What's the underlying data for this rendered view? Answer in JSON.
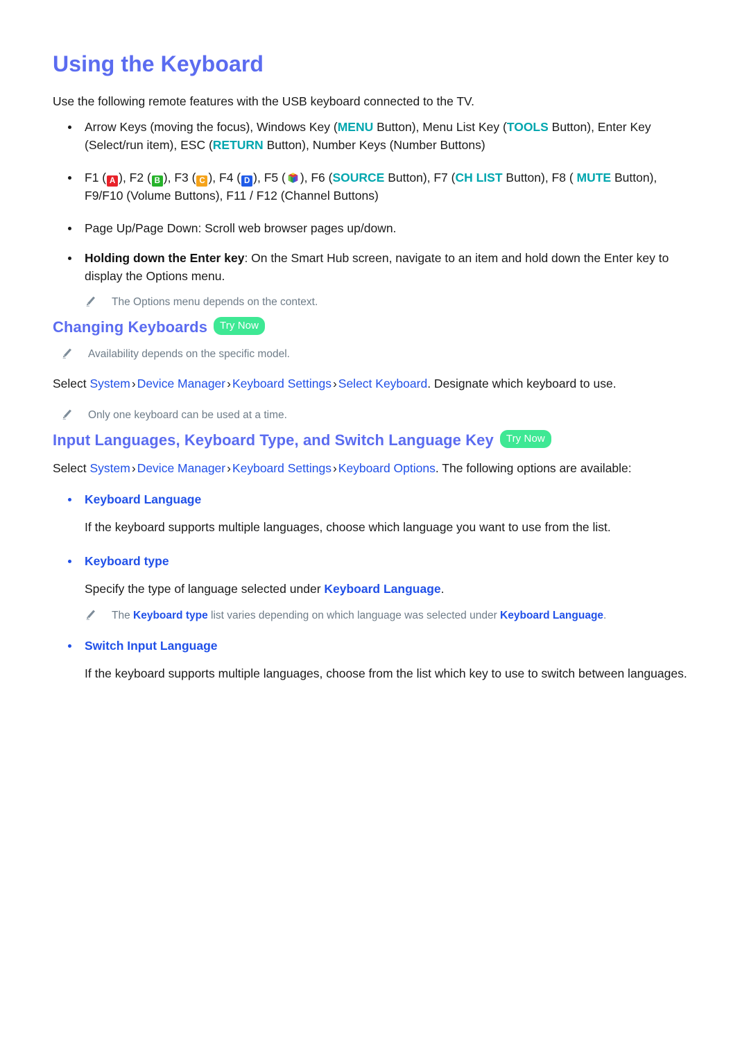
{
  "document": {
    "title": "Using the Keyboard",
    "intro": "Use the following remote features with the USB keyboard connected to the TV."
  },
  "bullets": {
    "arrow_keys": {
      "t1": "Arrow Keys (moving the focus), Windows Key (",
      "menu": "MENU",
      "t2": " Button), Menu List Key (",
      "tools": "TOOLS",
      "t3": " Button), Enter Key (Select/run item), ESC (",
      "return": "RETURN",
      "t4": " Button), Number Keys (Number Buttons)"
    },
    "function_keys": {
      "t1": "F1 (",
      "btn_a": "A",
      "t2": "), F2 (",
      "btn_b": "B",
      "t3": "), F3 (",
      "btn_c": "C",
      "t4": "), F4 (",
      "btn_d": "D",
      "t5": "), F5 (",
      "hub_icon": "smart-hub-icon",
      "t6": "), F6 (",
      "source": "SOURCE",
      "t7": " Button), F7 (",
      "ch_list": "CH LIST",
      "t8": " Button), F8 ( ",
      "mute": "MUTE",
      "t9": " Button), F9/F10 (Volume Buttons), F11 / F12 (Channel Buttons)"
    },
    "page_updown": "Page Up/Page Down: Scroll web browser pages up/down.",
    "enter_key": {
      "label": "Holding down the Enter key",
      "text": ": On the Smart Hub screen, navigate to an item and hold down the Enter key to display the Options menu."
    }
  },
  "notes": {
    "options_context": "The Options menu depends on the context.",
    "availability": "Availability depends on the specific model.",
    "one_keyboard": "Only one keyboard can be used at a time.",
    "keyboard_type_note": {
      "t1": "The ",
      "b1": "Keyboard type",
      "t2": " list varies depending on which language was selected under ",
      "b2": "Keyboard Language",
      "t3": "."
    }
  },
  "sections": {
    "changing_keyboards": {
      "heading": "Changing Keyboards",
      "badge": "Try Now",
      "path": {
        "prefix": "Select ",
        "items": [
          "System",
          "Device Manager",
          "Keyboard Settings",
          "Select Keyboard"
        ],
        "separator": "›",
        "suffix": ". Designate which keyboard to use."
      }
    },
    "input_languages": {
      "heading": "Input Languages, Keyboard Type, and Switch Language Key",
      "badge": "Try Now",
      "path": {
        "prefix": "Select ",
        "items": [
          "System",
          "Device Manager",
          "Keyboard Settings",
          "Keyboard Options"
        ],
        "separator": "›",
        "suffix": ". The following options are available:"
      },
      "options": [
        {
          "label": "Keyboard Language",
          "body": "If the keyboard supports multiple languages, choose which language you want to use from the list."
        },
        {
          "label": "Keyboard type",
          "body_pre": "Specify the type of language selected under ",
          "body_link": "Keyboard Language",
          "body_post": "."
        },
        {
          "label": "Switch Input Language",
          "body": "If the keyboard supports multiple languages, choose from the list which key to use to switch between languages."
        }
      ]
    }
  },
  "colors": {
    "heading_blue": "#5B6CF0",
    "link_blue": "#2050E8",
    "teal": "#00A6AE",
    "badge_green": "#3EE894",
    "note_gray": "#6E7C88",
    "key_a_red": "#E8222A",
    "key_b_green": "#26B32B",
    "key_c_orange": "#F5A31A",
    "key_d_blue": "#1F5BE8"
  }
}
